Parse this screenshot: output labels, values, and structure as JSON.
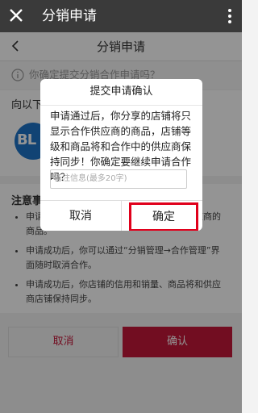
{
  "window": {
    "title": "分销申请"
  },
  "page": {
    "title": "分销申请"
  },
  "notice": {
    "text": "你确定提交分销合作申请吗？"
  },
  "section": {
    "label": "向以下供应商申请分销合作",
    "logo_text": "BL"
  },
  "notes": {
    "title": "注意事项",
    "items": [
      "申请通过后，你分享的店铺将只显示合作供应商的商品。",
      "申请成功后，你可以通过“分销管理→合作管理”界面随时取消合作。",
      "申请成功后，你店铺的信用和销量、商品将和供应商店铺保持同步。"
    ]
  },
  "footer": {
    "cancel_label": "取消",
    "confirm_label": "确认"
  },
  "dialog": {
    "title": "提交申请确认",
    "message": "申请通过后，你分享的店铺将只显示合作供应商的商品，店铺等级和商品将和合作中的供应商保持同步！你确定要继续申请合作吗？",
    "note_placeholder": "备注信息(最多20字)",
    "cancel_label": "取消",
    "confirm_label": "确定"
  },
  "icons": {
    "close": "close-icon",
    "more": "more-vertical-icon",
    "back": "chevron-left-icon",
    "info": "info-icon"
  },
  "colors": {
    "accent": "#c5173a",
    "highlight": "#e0001b",
    "topbar": "#3a3a3a"
  }
}
